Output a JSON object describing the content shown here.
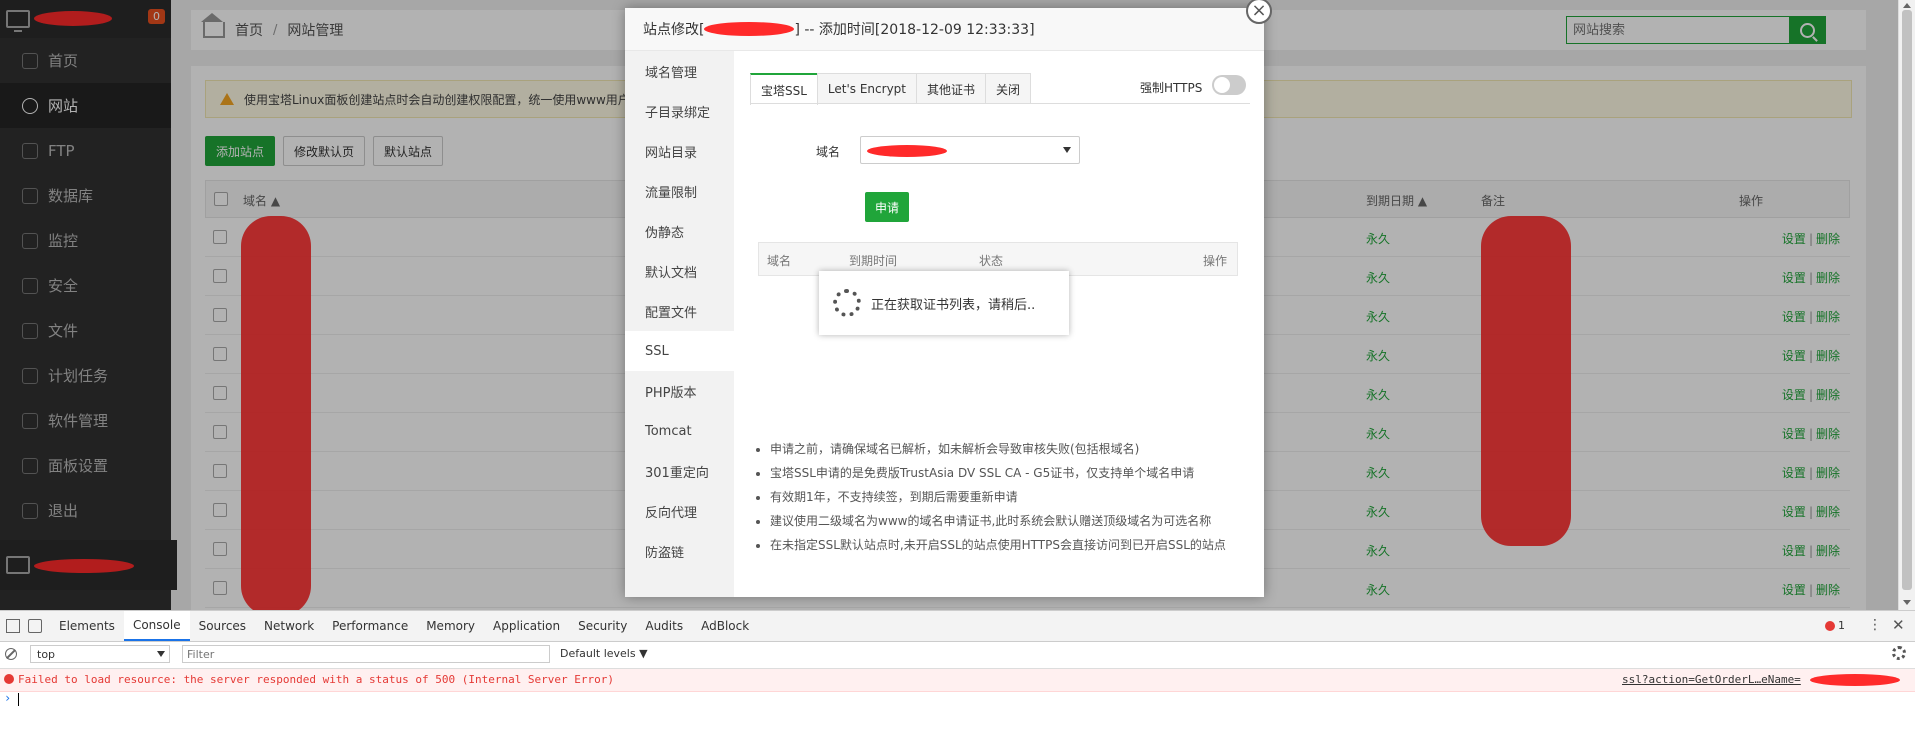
{
  "sidebar": {
    "badge_count": "0",
    "items": [
      {
        "label": "首页",
        "icon": "home-icon"
      },
      {
        "label": "网站",
        "icon": "globe-icon"
      },
      {
        "label": "FTP",
        "icon": "ftp-icon"
      },
      {
        "label": "数据库",
        "icon": "database-icon"
      },
      {
        "label": "监控",
        "icon": "monitor-chart-icon"
      },
      {
        "label": "安全",
        "icon": "shield-icon"
      },
      {
        "label": "文件",
        "icon": "folder-icon"
      },
      {
        "label": "计划任务",
        "icon": "calendar-icon"
      },
      {
        "label": "软件管理",
        "icon": "apps-icon"
      },
      {
        "label": "面板设置",
        "icon": "gear-icon"
      },
      {
        "label": "退出",
        "icon": "logout-icon"
      }
    ],
    "active_index": 1
  },
  "topbar": {
    "crumb_home": "首页",
    "crumb_sep": "/",
    "crumb_current": "网站管理",
    "search_placeholder": "网站搜索"
  },
  "content": {
    "notice": "使用宝塔Linux面板创建站点时会自动创建权限配置，统一使用www用户",
    "buttons": {
      "add_site": "添加站点",
      "modify_default_page": "修改默认页",
      "default_site": "默认站点"
    },
    "table_headers": {
      "domain": "域名 ▲",
      "expiry": "到期日期 ▲",
      "remark": "备注",
      "actions": "操作"
    },
    "rows": [
      {
        "expiry": "永久",
        "op_settings": "设置",
        "op_sep": "|",
        "op_delete": "删除"
      },
      {
        "expiry": "永久",
        "op_settings": "设置",
        "op_sep": "|",
        "op_delete": "删除"
      },
      {
        "expiry": "永久",
        "op_settings": "设置",
        "op_sep": "|",
        "op_delete": "删除"
      },
      {
        "expiry": "永久",
        "op_settings": "设置",
        "op_sep": "|",
        "op_delete": "删除"
      },
      {
        "expiry": "永久",
        "op_settings": "设置",
        "op_sep": "|",
        "op_delete": "删除"
      },
      {
        "expiry": "永久",
        "op_settings": "设置",
        "op_sep": "|",
        "op_delete": "删除"
      },
      {
        "expiry": "永久",
        "op_settings": "设置",
        "op_sep": "|",
        "op_delete": "删除"
      },
      {
        "expiry": "永久",
        "op_settings": "设置",
        "op_sep": "|",
        "op_delete": "删除"
      },
      {
        "expiry": "永久",
        "op_settings": "设置",
        "op_sep": "|",
        "op_delete": "删除"
      },
      {
        "expiry": "永久",
        "op_settings": "设置",
        "op_sep": "|",
        "op_delete": "删除"
      }
    ]
  },
  "dialog": {
    "title_prefix": "站点修改[",
    "title_suffix": "] -- 添加时间[2018-12-09 12:33:33]",
    "nav": [
      {
        "label": "域名管理"
      },
      {
        "label": "子目录绑定"
      },
      {
        "label": "网站目录"
      },
      {
        "label": "流量限制"
      },
      {
        "label": "伪静态"
      },
      {
        "label": "默认文档"
      },
      {
        "label": "配置文件"
      },
      {
        "label": "SSL"
      },
      {
        "label": "PHP版本"
      },
      {
        "label": "Tomcat"
      },
      {
        "label": "301重定向"
      },
      {
        "label": "反向代理"
      },
      {
        "label": "防盗链"
      }
    ],
    "nav_active_index": 7,
    "tabs": [
      {
        "label": "宝塔SSL"
      },
      {
        "label": "Let's Encrypt"
      },
      {
        "label": "其他证书"
      },
      {
        "label": "关闭"
      }
    ],
    "tab_active_index": 0,
    "force_https_label": "强制HTTPS",
    "force_https_on": false,
    "domain_label": "域名",
    "apply_button": "申请",
    "cert_table_headers": {
      "domain": "域名",
      "expiry": "到期时间",
      "status": "状态",
      "actions": "操作"
    },
    "loading_text": "正在获取证书列表，请稍后..",
    "notes": [
      "申请之前，请确保域名已解析，如未解析会导致审核失败(包括根域名)",
      "宝塔SSL申请的是免费版TrustAsia DV SSL CA - G5证书，仅支持单个域名申请",
      "有效期1年，不支持续签，到期后需要重新申请",
      "建议使用二级域名为www的域名申请证书,此时系统会默认赠送顶级域名为可选名称",
      "在未指定SSL默认站点时,未开启SSL的站点使用HTTPS会直接访问到已开启SSL的站点"
    ]
  },
  "devtools": {
    "tabs": [
      "Elements",
      "Console",
      "Sources",
      "Network",
      "Performance",
      "Memory",
      "Application",
      "Security",
      "Audits",
      "AdBlock"
    ],
    "active_tab_index": 1,
    "error_count": "1",
    "menu_glyph": "⋮",
    "close_glyph": "✕",
    "context": "top",
    "filter_placeholder": "Filter",
    "levels": "Default levels ▼",
    "error_message": "Failed to load resource: the server responded with a status of 500 (Internal Server Error)",
    "error_source": "ssl?action=GetOrderL…eName=",
    "prompt_glyph": "›"
  },
  "colors": {
    "accent_green": "#20a53a",
    "sidebar_bg": "#313131",
    "error_red": "#e53935"
  }
}
